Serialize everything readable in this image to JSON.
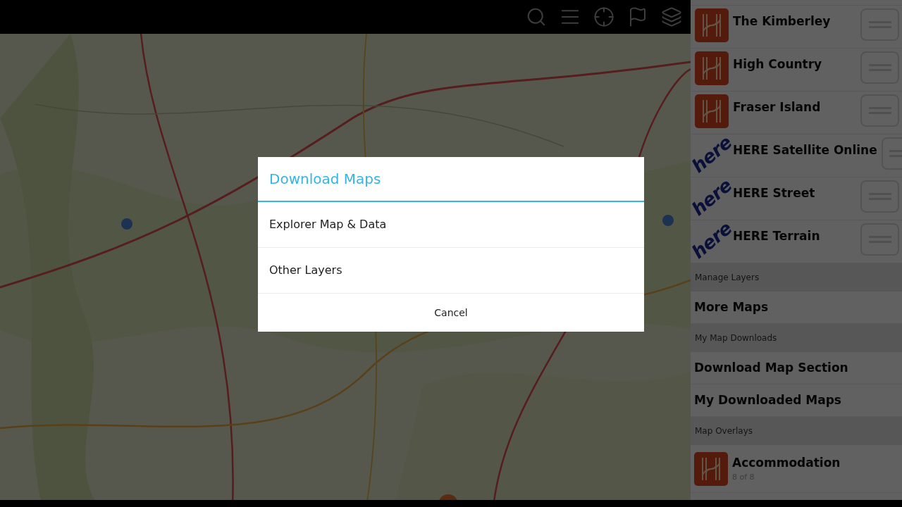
{
  "layers": [
    {
      "title": "The Kimberley",
      "kind": "hema"
    },
    {
      "title": "High Country",
      "kind": "hema"
    },
    {
      "title": "Fraser Island",
      "kind": "hema"
    },
    {
      "title": "HERE Satellite Online",
      "kind": "here",
      "logo_text": "here"
    },
    {
      "title": "HERE Street",
      "kind": "here",
      "logo_text": "here"
    },
    {
      "title": "HERE Terrain",
      "kind": "here",
      "logo_text": "here"
    }
  ],
  "sections": [
    {
      "header": "Manage Layers",
      "items": [
        {
          "title": "More Maps"
        }
      ]
    },
    {
      "header": "My Map Downloads",
      "items": [
        {
          "title": "Download Map Section"
        },
        {
          "title": "My Downloaded Maps"
        }
      ]
    },
    {
      "header": "Map Overlays",
      "items": [
        {
          "title": "Accommodation",
          "subtitle": "8 of 8",
          "kind": "hema"
        }
      ]
    }
  ],
  "dialog": {
    "title": "Download Maps",
    "options": [
      "Explorer Map & Data",
      "Other Layers"
    ],
    "button": "Cancel"
  }
}
